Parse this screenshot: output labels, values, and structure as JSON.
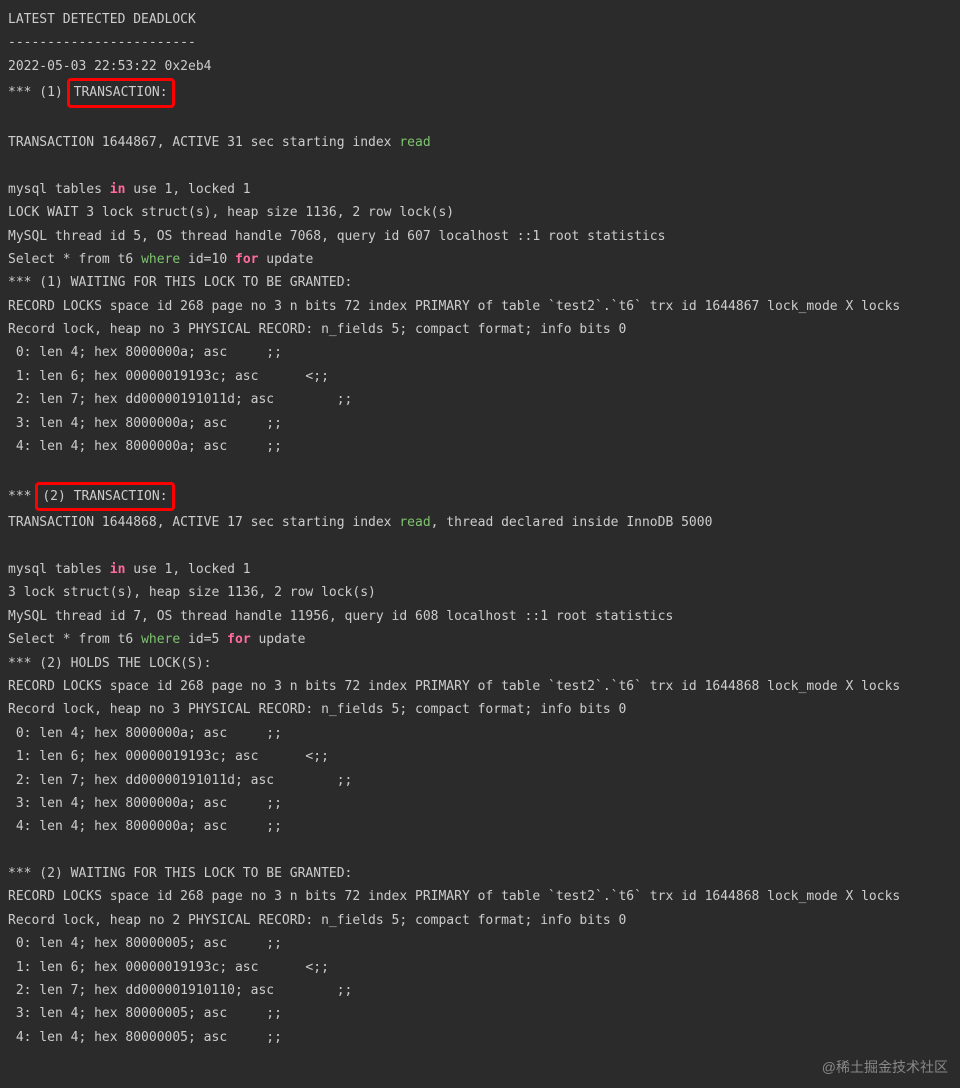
{
  "header": {
    "title": "LATEST DETECTED DEADLOCK",
    "separator": "------------------------",
    "timestamp": "2022-05-03 22:53:22 0x2eb4"
  },
  "tx1": {
    "marker_prefix": "*** (1) ",
    "marker_label": "TRANSACTION:",
    "header": "TRANSACTION 1644867, ACTIVE 31 sec starting index ",
    "header_kw": "read",
    "tables_pre": "mysql tables ",
    "tables_kw": "in",
    "tables_post": " use 1, locked 1",
    "lockwait": "LOCK WAIT 3 lock struct(s), heap size 1136, 2 row lock(s)",
    "thread": "MySQL thread id 5, OS thread handle 7068, query id 607 localhost ::1 root statistics",
    "sql_pre": "Select * from t6 ",
    "sql_where": "where",
    "sql_mid": " id=10 ",
    "sql_for": "for",
    "sql_post": " update",
    "waiting_header": "*** (1) WAITING FOR THIS LOCK TO BE GRANTED:",
    "waiting_locks": "RECORD LOCKS space id 268 page no 3 n bits 72 index PRIMARY of table `test2`.`t6` trx id 1644867 lock_mode X locks",
    "waiting_record": "Record lock, heap no 3 PHYSICAL RECORD: n_fields 5; compact format; info bits 0",
    "fields": [
      " 0: len 4; hex 8000000a; asc     ;;",
      " 1: len 6; hex 00000019193c; asc      <;;",
      " 2: len 7; hex dd00000191011d; asc        ;;",
      " 3: len 4; hex 8000000a; asc     ;;",
      " 4: len 4; hex 8000000a; asc     ;;"
    ]
  },
  "tx2": {
    "marker_prefix": "*** ",
    "marker_label": "(2) TRANSACTION:",
    "header": "TRANSACTION 1644868, ACTIVE 17 sec starting index ",
    "header_kw": "read",
    "header_post": ", thread declared inside InnoDB 5000",
    "tables_pre": "mysql tables ",
    "tables_kw": "in",
    "tables_post": " use 1, locked 1",
    "lockstruct": "3 lock struct(s), heap size 1136, 2 row lock(s)",
    "thread": "MySQL thread id 7, OS thread handle 11956, query id 608 localhost ::1 root statistics",
    "sql_pre": "Select * from t6 ",
    "sql_where": "where",
    "sql_mid": " id=5 ",
    "sql_for": "for",
    "sql_post": " update",
    "holds_header": "*** (2) HOLDS THE LOCK(S):",
    "holds_locks": "RECORD LOCKS space id 268 page no 3 n bits 72 index PRIMARY of table `test2`.`t6` trx id 1644868 lock_mode X locks",
    "holds_record": "Record lock, heap no 3 PHYSICAL RECORD: n_fields 5; compact format; info bits 0",
    "holds_fields": [
      " 0: len 4; hex 8000000a; asc     ;;",
      " 1: len 6; hex 00000019193c; asc      <;;",
      " 2: len 7; hex dd00000191011d; asc        ;;",
      " 3: len 4; hex 8000000a; asc     ;;",
      " 4: len 4; hex 8000000a; asc     ;;"
    ],
    "waiting_header": "*** (2) WAITING FOR THIS LOCK TO BE GRANTED:",
    "waiting_locks": "RECORD LOCKS space id 268 page no 3 n bits 72 index PRIMARY of table `test2`.`t6` trx id 1644868 lock_mode X locks",
    "waiting_record": "Record lock, heap no 2 PHYSICAL RECORD: n_fields 5; compact format; info bits 0",
    "waiting_fields": [
      " 0: len 4; hex 80000005; asc     ;;",
      " 1: len 6; hex 00000019193c; asc      <;;",
      " 2: len 7; hex dd000001910110; asc        ;;",
      " 3: len 4; hex 80000005; asc     ;;",
      " 4: len 4; hex 80000005; asc     ;;"
    ]
  },
  "watermark": "@稀土掘金技术社区"
}
